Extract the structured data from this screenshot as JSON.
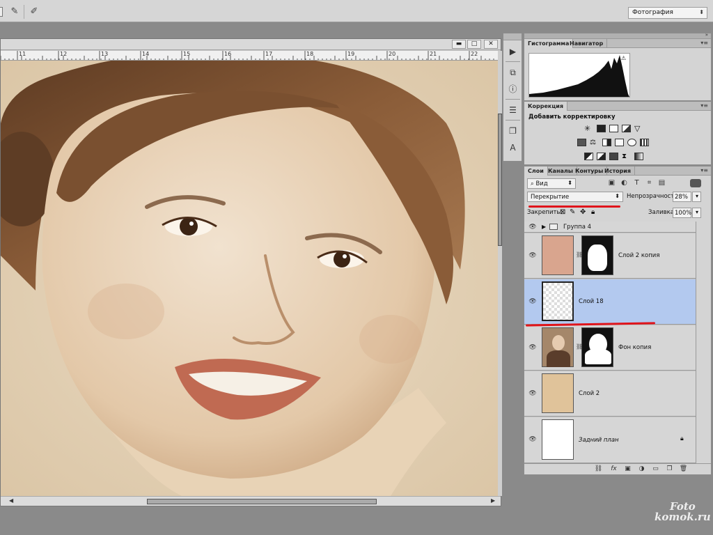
{
  "workspace": {
    "selected": "Фотография"
  },
  "ruler": {
    "ticks": [
      "11",
      "12",
      "13",
      "14",
      "15",
      "16",
      "17",
      "18",
      "19",
      "20",
      "21",
      "22"
    ]
  },
  "histogram_panel": {
    "tabs": [
      "Гистограмма",
      "Навигатор"
    ]
  },
  "correction_panel": {
    "tab": "Коррекция",
    "title": "Добавить корректировку"
  },
  "layers_panel": {
    "tabs": [
      "Слои",
      "Каналы",
      "Контуры",
      "История"
    ],
    "filter": "Вид",
    "blend_mode": "Перекрытие",
    "opacity_label": "Непрозрачность:",
    "opacity": "28%",
    "lock_label": "Закрепить:",
    "fill_label": "Заливка:",
    "fill": "100%",
    "layers": [
      {
        "name": "Группа 4"
      },
      {
        "name": "Слой 2 копия"
      },
      {
        "name": "Слой 18"
      },
      {
        "name": "Фон копия"
      },
      {
        "name": "Слой 2"
      },
      {
        "name": "Задний план"
      }
    ]
  },
  "watermark": {
    "line1": "Foto",
    "line2": "komok.ru"
  },
  "colors": {
    "selection": "#b3c9ef",
    "annotation": "#e0141b",
    "sepia": "#c9a27c"
  }
}
